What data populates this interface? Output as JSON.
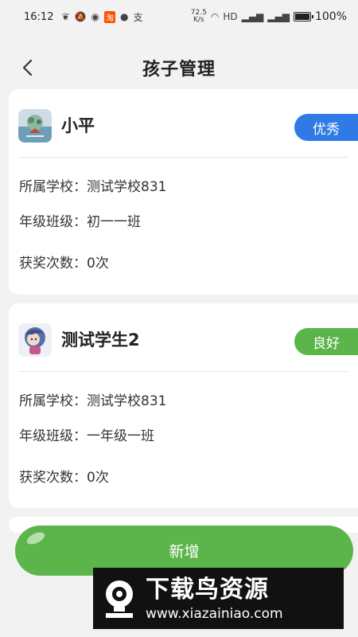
{
  "status_bar": {
    "time": "16:12",
    "net_speed_value": "72.5",
    "net_speed_unit": "K/s",
    "battery_percent_value": 100,
    "battery_percent": "100%",
    "app_icons": [
      "heart-icon",
      "bell-off-icon",
      "wechat-icon",
      "taobao-icon",
      "message-icon",
      "alipay-icon"
    ]
  },
  "header": {
    "title": "孩子管理",
    "back_icon": "chevron-left-icon"
  },
  "children": [
    {
      "name": "小平",
      "rating": "优秀",
      "rating_color": "#2f7ae5",
      "school_label": "所属学校：",
      "school": "测试学校831",
      "class_label": "年级班级：",
      "class": "初一一班",
      "awards_label": "获奖次数：",
      "awards": "0次"
    },
    {
      "name": "测试学生2",
      "rating": "良好",
      "rating_color": "#5cb54b",
      "school_label": "所属学校：",
      "school": "测试学校831",
      "class_label": "年级班级：",
      "class": "一年级一班",
      "awards_label": "获奖次数：",
      "awards": "0次"
    }
  ],
  "add_button": {
    "label": "新增",
    "color": "#5cb54b"
  },
  "watermark": {
    "title": "下载鸟资源",
    "url": "www.xiazainiao.com"
  }
}
